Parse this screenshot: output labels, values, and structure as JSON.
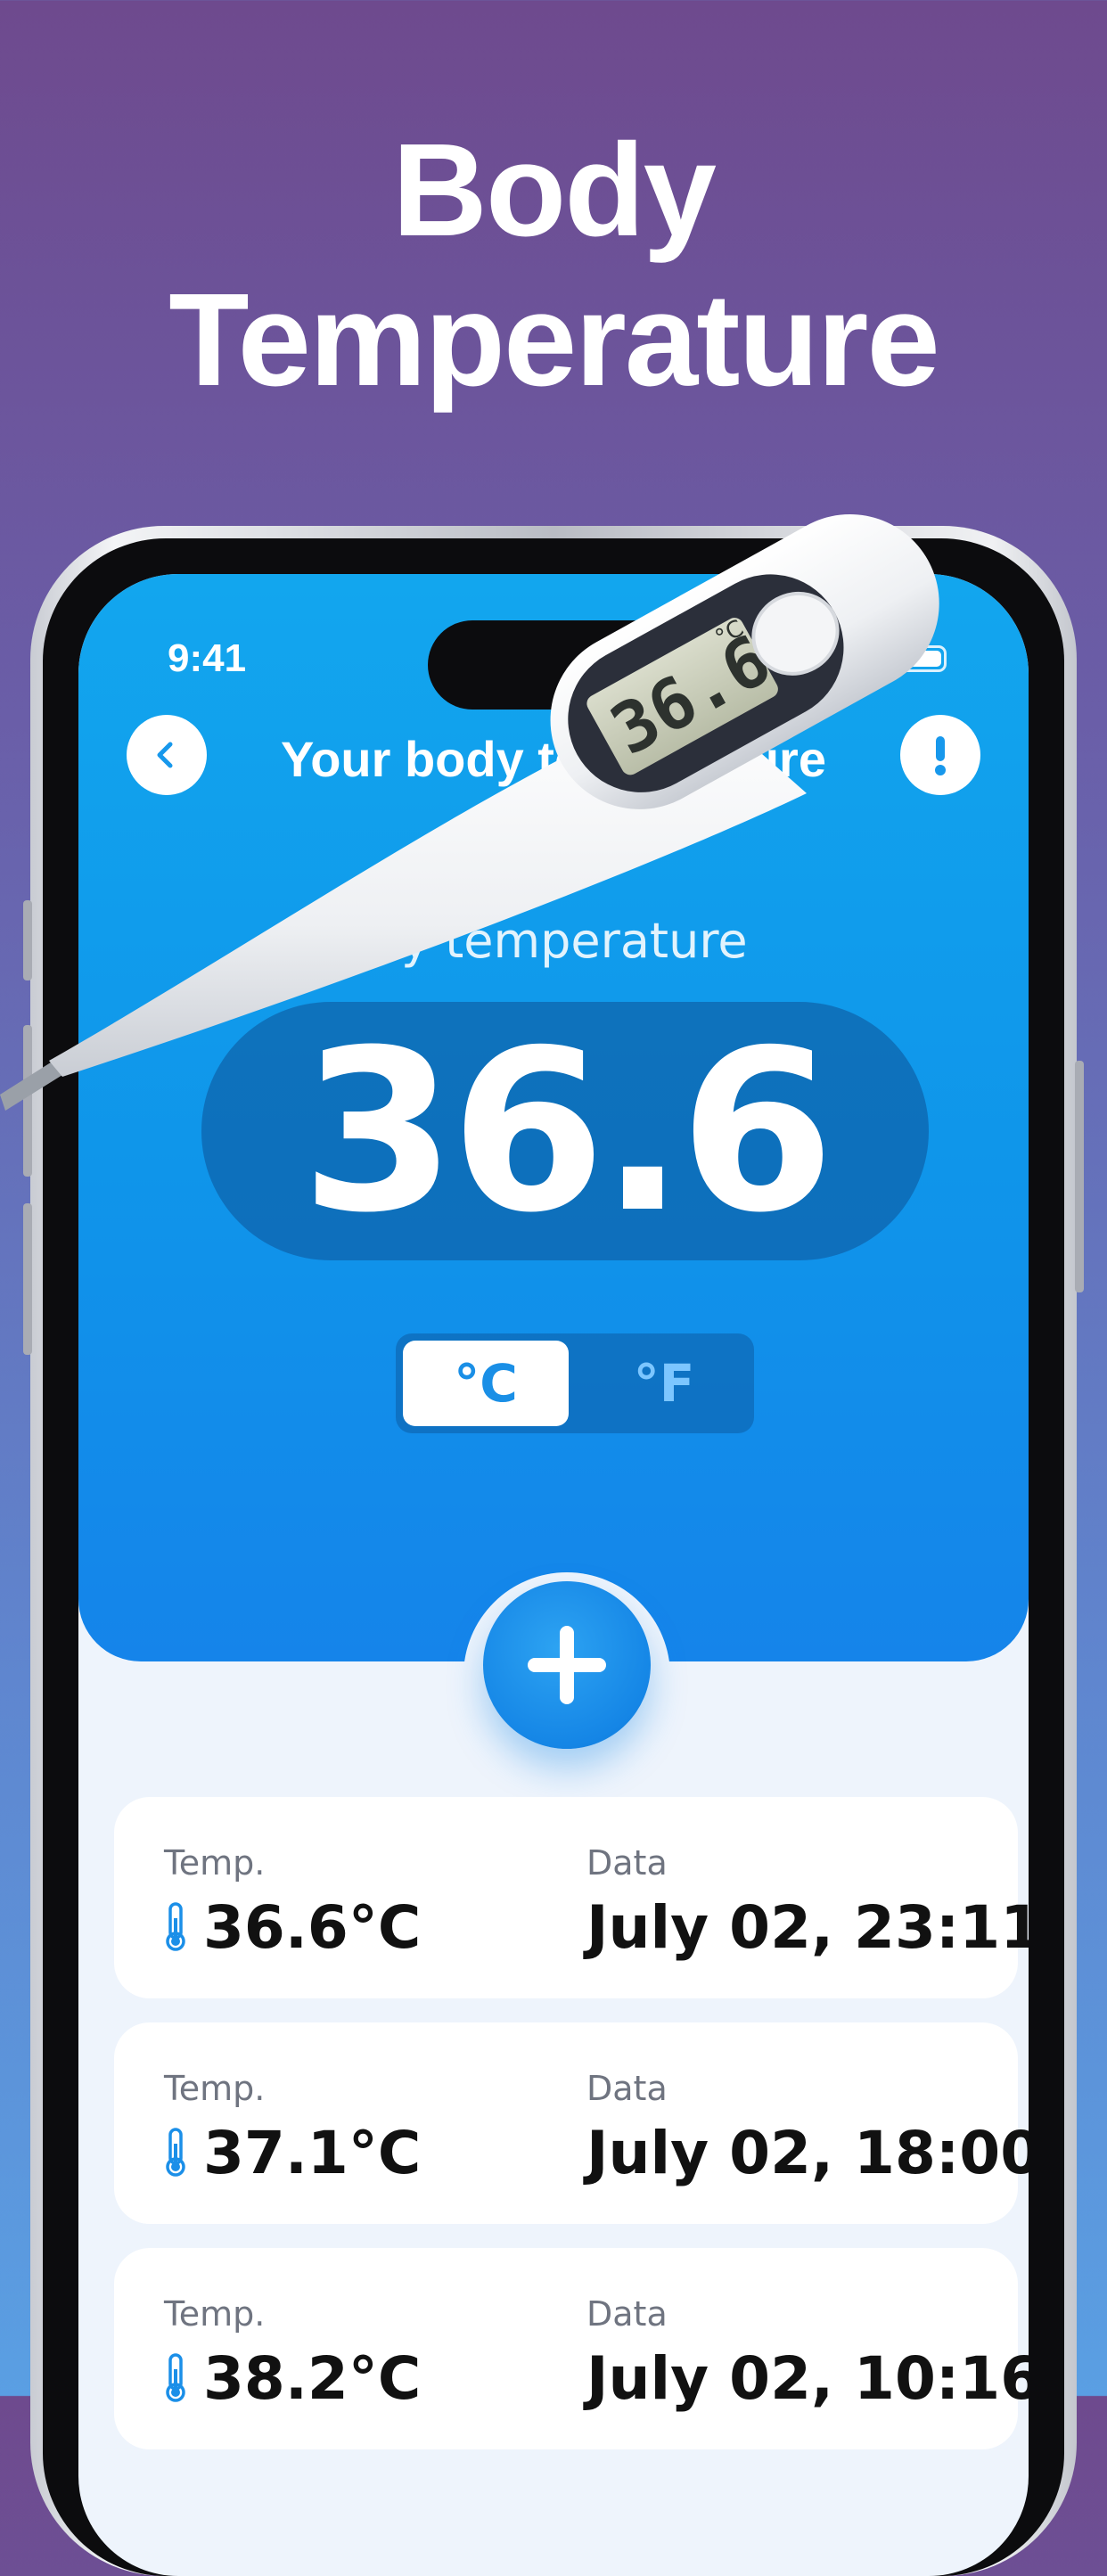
{
  "headline": {
    "line1": "Body",
    "line2": "Temperature"
  },
  "status": {
    "time": "9:41"
  },
  "nav": {
    "back_icon": "chevron-left-icon",
    "title": "Your body temperature",
    "info_icon": "exclamation-icon"
  },
  "main": {
    "label": "My temperature",
    "value": "36.6",
    "units": {
      "celsius": "°C",
      "fahrenheit": "°F",
      "selected": "°C"
    }
  },
  "thermometer": {
    "display": "36.6",
    "unit": "°C"
  },
  "add_button": {
    "icon": "plus-icon"
  },
  "records": [
    {
      "temp_label": "Temp.",
      "temp": "36.6°C",
      "date_label": "Data",
      "date": "July 02, 23:11"
    },
    {
      "temp_label": "Temp.",
      "temp": "37.1°C",
      "date_label": "Data",
      "date": "July 02, 18:00"
    },
    {
      "temp_label": "Temp.",
      "temp": "38.2°C",
      "date_label": "Data",
      "date": "July 02, 10:16"
    }
  ],
  "colors": {
    "accent": "#1798ec",
    "primary_blue": "#1584ea",
    "background_top": "#6e4a8e",
    "background_bottom": "#5a9fe3"
  }
}
